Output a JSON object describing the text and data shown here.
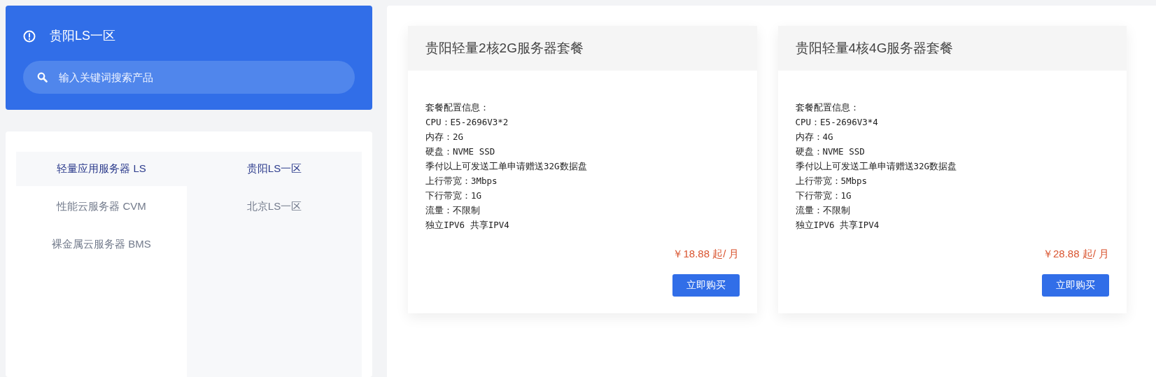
{
  "header": {
    "title": "贵阳LS一区",
    "search": {
      "placeholder": "输入关键词搜索产品"
    }
  },
  "categories": [
    {
      "label": "轻量应用服务器 LS",
      "selected": true
    },
    {
      "label": "性能云服务器 CVM",
      "selected": false
    },
    {
      "label": "裸金属云服务器 BMS",
      "selected": false
    }
  ],
  "zones": [
    {
      "label": "贵阳LS一区",
      "selected": true
    },
    {
      "label": "北京LS一区",
      "selected": false
    }
  ],
  "products": [
    {
      "title": "贵阳轻量2核2G服务器套餐",
      "specs": [
        "套餐配置信息：",
        "CPU：E5-2696V3*2",
        "内存：2G",
        "硬盘：NVME SSD",
        "季付以上可发送工单申请赠送32G数据盘",
        "上行带宽：3Mbps",
        "下行带宽：1G",
        "流量：不限制",
        "独立IPV6 共享IPV4"
      ],
      "price": "￥18.88 起/ 月",
      "button": "立即购买"
    },
    {
      "title": "贵阳轻量4核4G服务器套餐",
      "specs": [
        "套餐配置信息：",
        "CPU：E5-2696V3*4",
        "内存：4G",
        "硬盘：NVME SSD",
        "季付以上可发送工单申请赠送32G数据盘",
        "上行带宽：5Mbps",
        "下行带宽：1G",
        "流量：不限制",
        "独立IPV6 共享IPV4"
      ],
      "price": "￥28.88 起/ 月",
      "button": "立即购买"
    }
  ]
}
